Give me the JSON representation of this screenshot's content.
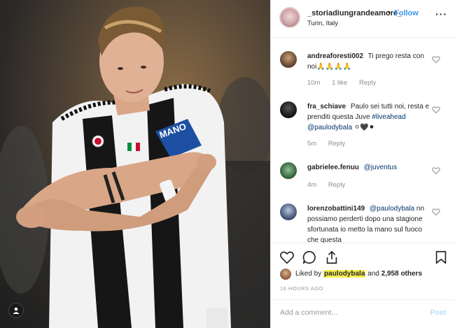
{
  "post": {
    "username": "_storiadiungrandeamore_",
    "dot": "•",
    "follow_label": "Follow",
    "location": "Turin, Italy",
    "more_label": "···"
  },
  "comments": [
    {
      "user": "andreaforesti002",
      "text": "Ti prego resta con noi🙏🙏🙏🙏",
      "time": "10m",
      "likes": "1 like",
      "reply": "Reply"
    },
    {
      "user": "fra_schiave",
      "text": "Paulo sei tutti noi, resta e prenditi questa Juve",
      "tag": "#liveahead",
      "mention": "@paulodybala",
      "suffix": "⚪🖤⚫",
      "time": "5m",
      "reply": "Reply"
    },
    {
      "user": "gabrielee.fenuu",
      "mention": "@juventus",
      "time": "4m",
      "reply": "Reply"
    },
    {
      "user": "lorenzobattini149",
      "mention": "@paulodybala",
      "text": "nn possiamo perderti dopo una stagione sfortunata io metto la mano sul fuoco che questa"
    }
  ],
  "likes": {
    "prefix": "Liked by",
    "user": "paulodybala",
    "and": "and",
    "count": "2,958 others"
  },
  "timeago": "16 HOURS AGO",
  "add_comment": {
    "placeholder": "Add a comment...",
    "post_label": "Post"
  },
  "photo": {
    "armband_text": "MANO"
  },
  "colors": {
    "link_blue": "#3897f0",
    "mention_blue": "#003569",
    "highlight": "#f7f052"
  }
}
